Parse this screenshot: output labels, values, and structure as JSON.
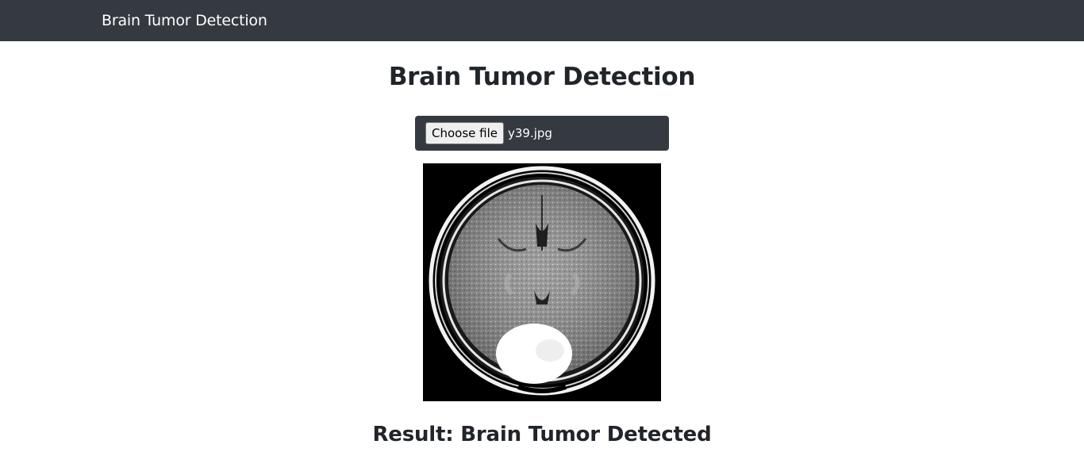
{
  "navbar": {
    "brand": "Brain Tumor Detection"
  },
  "main": {
    "title": "Brain Tumor Detection",
    "upload": {
      "button_label": "Choose file",
      "file_name": "y39.jpg"
    },
    "result_text": "Result: Brain Tumor Detected"
  },
  "colors": {
    "navbar_bg": "#343a40",
    "page_bg": "#ffffff",
    "text": "#212529"
  }
}
